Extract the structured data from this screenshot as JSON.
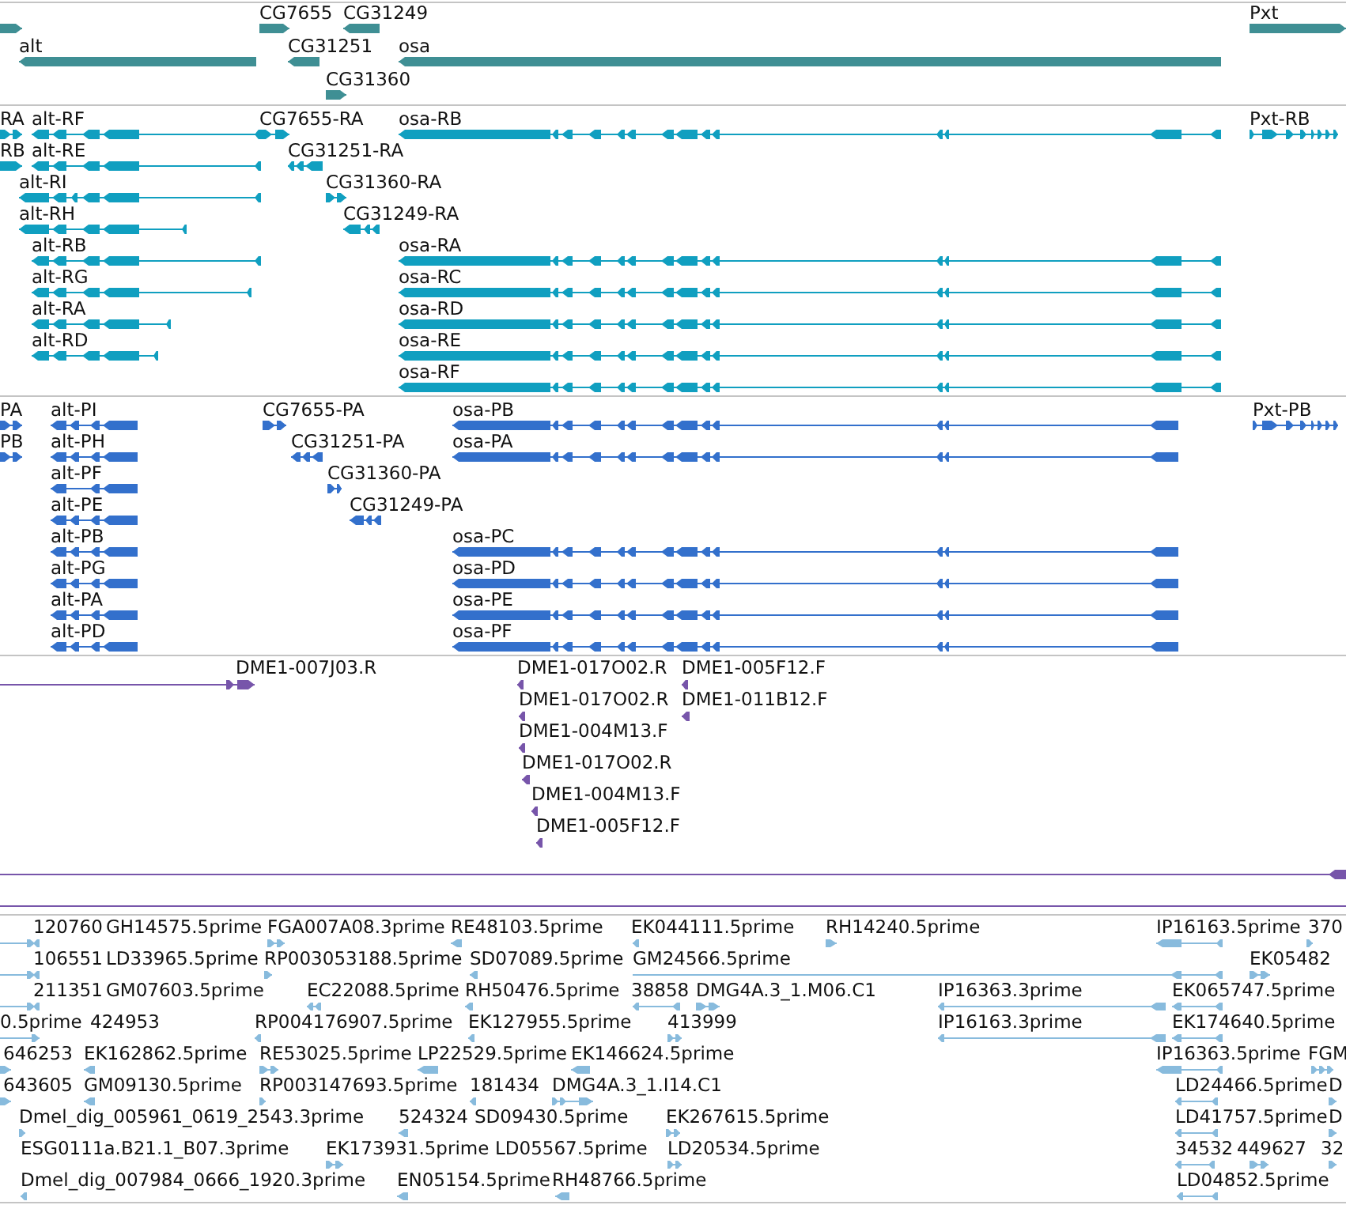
{
  "tracks": [
    {
      "kind": "genes",
      "color": "#3f8f94",
      "features": [
        {
          "kind": "forward"
        },
        {
          "label": "CG7655",
          "kind": "forward"
        },
        {
          "label": "CG31249",
          "kind": "reverse"
        },
        {
          "label": "Pxt",
          "kind": "forward"
        },
        {
          "label": "alt",
          "kind": "reverse"
        },
        {
          "label": "CG31251",
          "kind": "reverse"
        },
        {
          "label": "osa",
          "kind": "reverse"
        },
        {
          "label": "CG31360",
          "kind": "forward"
        }
      ]
    },
    {
      "kind": "transcripts",
      "color": "#109fc0",
      "features": [
        {
          "label": "RA",
          "kind": "forward"
        },
        {
          "label": "alt-RF",
          "kind": "reverse"
        },
        {
          "label": "CG7655-RA",
          "kind": "forward"
        },
        {
          "label": "osa-RB",
          "kind": "reverse"
        },
        {
          "label": "Pxt-RB",
          "kind": "forward"
        },
        {
          "label": "RB",
          "kind": "forward"
        },
        {
          "label": "alt-RE",
          "kind": "reverse"
        },
        {
          "label": "CG31251-RA",
          "kind": "reverse"
        },
        {
          "label": "alt-RI",
          "kind": "reverse"
        },
        {
          "label": "CG31360-RA",
          "kind": "forward"
        },
        {
          "label": "alt-RH",
          "kind": "reverse"
        },
        {
          "label": "CG31249-RA",
          "kind": "reverse"
        },
        {
          "label": "alt-RB",
          "kind": "reverse"
        },
        {
          "label": "osa-RA",
          "kind": "reverse"
        },
        {
          "label": "alt-RG",
          "kind": "reverse"
        },
        {
          "label": "osa-RC",
          "kind": "reverse"
        },
        {
          "label": "alt-RA",
          "kind": "reverse"
        },
        {
          "label": "osa-RD",
          "kind": "reverse"
        },
        {
          "label": "alt-RD",
          "kind": "reverse"
        },
        {
          "label": "osa-RE",
          "kind": "reverse"
        },
        {
          "label": "osa-RF",
          "kind": "reverse"
        }
      ]
    },
    {
      "kind": "proteins",
      "color": "#3370cc",
      "features": [
        {
          "label": "PA",
          "kind": "forward"
        },
        {
          "label": "alt-PI",
          "kind": "reverse"
        },
        {
          "label": "CG7655-PA",
          "kind": "forward"
        },
        {
          "label": "osa-PB",
          "kind": "reverse"
        },
        {
          "label": "Pxt-PB",
          "kind": "forward"
        },
        {
          "label": "PB",
          "kind": "forward"
        },
        {
          "label": "alt-PH",
          "kind": "reverse"
        },
        {
          "label": "CG31251-PA",
          "kind": "reverse"
        },
        {
          "label": "osa-PA",
          "kind": "reverse"
        },
        {
          "label": "alt-PF",
          "kind": "reverse"
        },
        {
          "label": "CG31360-PA",
          "kind": "forward"
        },
        {
          "label": "alt-PE",
          "kind": "reverse"
        },
        {
          "label": "CG31249-PA",
          "kind": "reverse"
        },
        {
          "label": "alt-PB",
          "kind": "reverse"
        },
        {
          "label": "osa-PC",
          "kind": "reverse"
        },
        {
          "label": "alt-PG",
          "kind": "reverse"
        },
        {
          "label": "osa-PD",
          "kind": "reverse"
        },
        {
          "label": "alt-PA",
          "kind": "reverse"
        },
        {
          "label": "osa-PE",
          "kind": "reverse"
        },
        {
          "label": "alt-PD",
          "kind": "reverse"
        },
        {
          "label": "osa-PF",
          "kind": "reverse"
        }
      ]
    },
    {
      "kind": "ests",
      "color": "#7755aa",
      "features": [
        {
          "label": "DME1-007J03.R",
          "kind": "forward"
        },
        {
          "label": "DME1-017O02.R",
          "kind": "reverse"
        },
        {
          "label": "DME1-005F12.F",
          "kind": "reverse"
        },
        {
          "label": "DME1-017O02.R",
          "kind": "reverse"
        },
        {
          "label": "DME1-011B12.F",
          "kind": "reverse"
        },
        {
          "label": "DME1-004M13.F",
          "kind": "reverse"
        },
        {
          "label": "DME1-017O02.R",
          "kind": "reverse"
        },
        {
          "label": "DME1-004M13.F",
          "kind": "reverse"
        },
        {
          "label": "DME1-005F12.F",
          "kind": "reverse"
        },
        {
          "kind": "reverse"
        },
        {
          "kind": "line"
        }
      ]
    },
    {
      "kind": "cdnas",
      "color": "#88bbdd",
      "features": [
        {
          "kind": "forward"
        },
        {
          "label": "120760",
          "kind": "reverse"
        },
        {
          "label": "GH14575.5prime"
        },
        {
          "label": "FGA007A08.3prime",
          "kind": "forward"
        },
        {
          "label": "RE48103.5prime",
          "kind": "reverse"
        },
        {
          "label": "EK044111.5prime",
          "kind": "reverse"
        },
        {
          "label": "RH14240.5prime",
          "kind": "forward"
        },
        {
          "label": "IP16163.5prime",
          "kind": "reverse"
        },
        {
          "label": "370",
          "kind": "forward"
        },
        {
          "kind": "forward"
        },
        {
          "label": "106551",
          "kind": "reverse"
        },
        {
          "label": "LD33965.5prime"
        },
        {
          "label": "RP003053188.5prime",
          "kind": "forward"
        },
        {
          "label": "SD07089.5prime",
          "kind": "reverse"
        },
        {
          "label": "GM24566.5prime",
          "kind": "reverse"
        },
        {
          "label": "EK05482",
          "kind": "forward"
        },
        {
          "kind": "forward"
        },
        {
          "label": "211351",
          "kind": "reverse"
        },
        {
          "label": "GM07603.5prime"
        },
        {
          "label": "EC22088.5prime",
          "kind": "reverse"
        },
        {
          "label": "RH50476.5prime",
          "kind": "reverse"
        },
        {
          "label": "38858",
          "kind": "reverse"
        },
        {
          "label": "DMG4A.3_1.M06.C1",
          "kind": "forward"
        },
        {
          "label": "IP16363.3prime",
          "kind": "reverse"
        },
        {
          "label": "EK065747.5prime",
          "kind": "reverse"
        },
        {
          "label": "0.5prime",
          "kind": "forward"
        },
        {
          "label": "424953"
        },
        {
          "label": "RP004176907.5prime",
          "kind": "reverse"
        },
        {
          "label": "EK127955.5prime",
          "kind": "reverse"
        },
        {
          "label": "413999",
          "kind": "forward"
        },
        {
          "label": "IP16163.3prime",
          "kind": "reverse"
        },
        {
          "label": "EK174640.5prime",
          "kind": "reverse"
        },
        {
          "label": "646253",
          "kind": "forward"
        },
        {
          "label": "EK162862.5prime",
          "kind": "reverse"
        },
        {
          "label": "RE53025.5prime",
          "kind": "forward"
        },
        {
          "label": "LP22529.5prime",
          "kind": "reverse"
        },
        {
          "label": "EK146624.5prime",
          "kind": "reverse"
        },
        {
          "label": "IP16363.5prime",
          "kind": "reverse"
        },
        {
          "label": "FGM",
          "kind": "forward"
        },
        {
          "label": "643605",
          "kind": "forward"
        },
        {
          "label": "GM09130.5prime",
          "kind": "reverse"
        },
        {
          "label": "RP003147693.5prime",
          "kind": "forward"
        },
        {
          "label": "181434",
          "kind": "reverse"
        },
        {
          "label": "DMG4A.3_1.I14.C1",
          "kind": "forward"
        },
        {
          "label": "LD24466.5prime",
          "kind": "reverse"
        },
        {
          "label": "D",
          "kind": "forward"
        },
        {
          "label": "Dmel_dig_005961_0619_2543.3prime",
          "kind": "forward"
        },
        {
          "label": "524324",
          "kind": "reverse"
        },
        {
          "label": "SD09430.5prime"
        },
        {
          "label": "EK267615.5prime",
          "kind": "forward"
        },
        {
          "label": "LD41757.5prime",
          "kind": "reverse"
        },
        {
          "label": "D",
          "kind": "forward"
        },
        {
          "label": "ESG0111a.B21.1_B07.3prime"
        },
        {
          "label": "EK173931.5prime",
          "kind": "forward"
        },
        {
          "label": "LD05567.5prime"
        },
        {
          "label": "LD20534.5prime",
          "kind": "forward"
        },
        {
          "label": "34532",
          "kind": "reverse"
        },
        {
          "label": "449627",
          "kind": "forward"
        },
        {
          "label": "32",
          "kind": "forward"
        },
        {
          "label": "Dmel_dig_007984_0666_1920.3prime",
          "kind": "reverse"
        },
        {
          "label": "EN05154.5prime",
          "kind": "reverse"
        },
        {
          "label": "RH48766.5prime",
          "kind": "reverse"
        },
        {
          "label": "LD04852.5prime",
          "kind": "reverse"
        }
      ]
    }
  ]
}
